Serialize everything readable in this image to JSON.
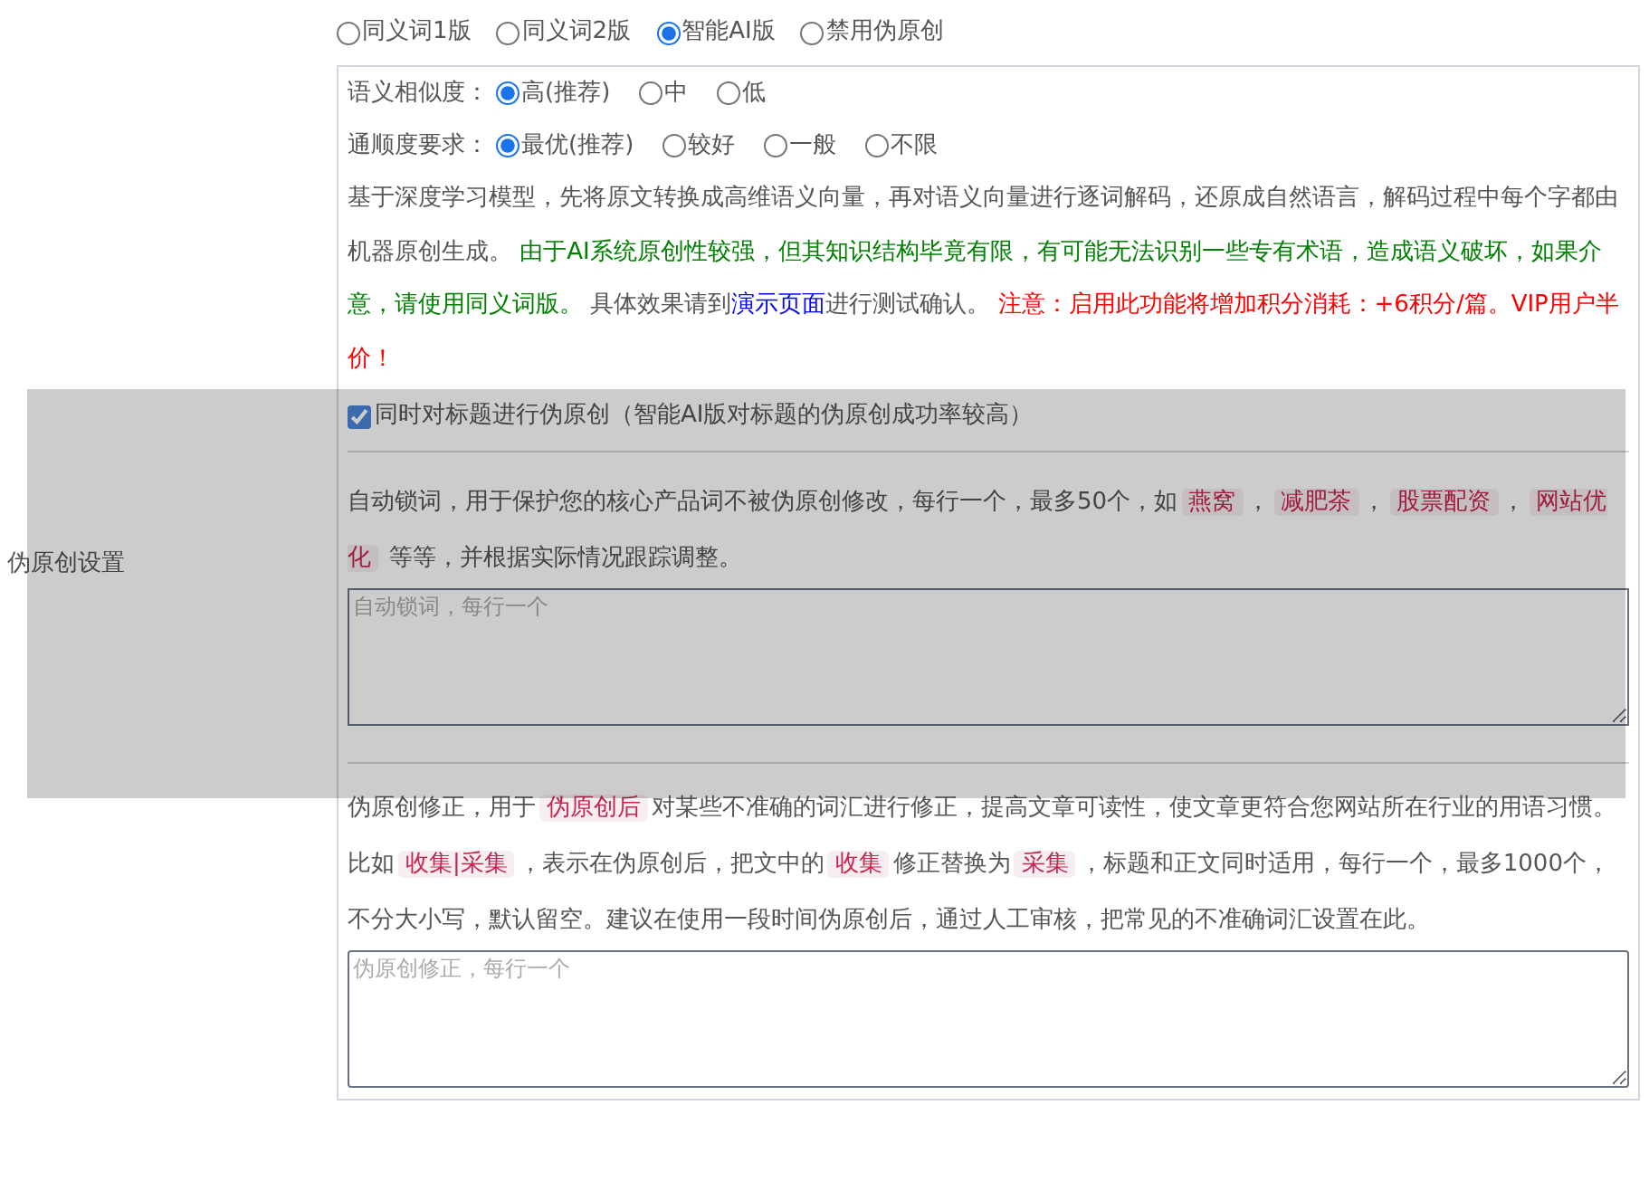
{
  "mode_options": [
    {
      "label": "同义词1版",
      "selected": false
    },
    {
      "label": "同义词2版",
      "selected": false
    },
    {
      "label": "智能AI版",
      "selected": true
    },
    {
      "label": "禁用伪原创",
      "selected": false
    }
  ],
  "settings": [
    {
      "label": "语义相似度：",
      "options": [
        {
          "label": "高(推荐)",
          "selected": true
        },
        {
          "label": "中",
          "selected": false
        },
        {
          "label": "低",
          "selected": false
        }
      ]
    },
    {
      "label": "通顺度要求：",
      "options": [
        {
          "label": "最优(推荐)",
          "selected": true
        },
        {
          "label": "较好",
          "selected": false
        },
        {
          "label": "一般",
          "selected": false
        },
        {
          "label": "不限",
          "selected": false
        }
      ]
    }
  ],
  "description": [
    {
      "kind": "plain",
      "text": "基于深度学习模型，先将原文转换成高维语义向量，再对语义向量进行逐词解码，还原成自然语言，解码过程中每个字都由机器原创生成。 "
    },
    {
      "kind": "notice",
      "text": "由于AI系统原创性较强，但其知识结构毕竟有限，有可能无法识别一些专有术语，造成语义破坏，如果介意，请使用同义词版。"
    },
    {
      "kind": "plain",
      "text": " 具体效果请到"
    },
    {
      "kind": "link",
      "text": "演示页面"
    },
    {
      "kind": "plain",
      "text": "进行测试确认。 "
    },
    {
      "kind": "warning",
      "text": "注意：启用此功能将增加积分消耗：+6积分/篇。VIP用户半价！"
    }
  ],
  "section_label": "伪原创设置",
  "title_checkbox": {
    "label": "同时对标题进行伪原创（智能AI版对标题的伪原创成功率较高）",
    "checked": true
  },
  "lock_words": {
    "segments": [
      {
        "kind": "plain",
        "text": "自动锁词，用于保护您的核心产品词不被伪原创修改，每行一个，最多50个，如"
      },
      {
        "kind": "tag",
        "text": "燕窝"
      },
      {
        "kind": "plain",
        "text": "，"
      },
      {
        "kind": "tag",
        "text": "减肥茶"
      },
      {
        "kind": "plain",
        "text": "，"
      },
      {
        "kind": "tag",
        "text": "股票配资"
      },
      {
        "kind": "plain",
        "text": "，"
      },
      {
        "kind": "tag",
        "text": "网站优化"
      },
      {
        "kind": "plain",
        "text": " 等等，并根据实际情况跟踪调整。"
      }
    ],
    "placeholder": "自动锁词，每行一个"
  },
  "correction": {
    "segments": [
      {
        "kind": "plain",
        "text": "伪原创修正，用于"
      },
      {
        "kind": "tag",
        "text": "伪原创后"
      },
      {
        "kind": "plain",
        "text": "对某些不准确的词汇进行修正，提高文章可读性，使文章更符合您网站所在行业的用语习惯。比如"
      },
      {
        "kind": "tag",
        "text": "收集|采集"
      },
      {
        "kind": "plain",
        "text": "，表示在伪原创后，把文中的"
      },
      {
        "kind": "tag",
        "text": "收集"
      },
      {
        "kind": "plain",
        "text": "修正替换为"
      },
      {
        "kind": "tag",
        "text": "采集"
      },
      {
        "kind": "plain",
        "text": "，标题和正文同时适用，每行一个，最多1000个，不分大小写，默认留空。建议在使用一段时间伪原创后，通过人工审核，把常见的不准确词汇设置在此。"
      }
    ],
    "placeholder": "伪原创修正，每行一个"
  }
}
